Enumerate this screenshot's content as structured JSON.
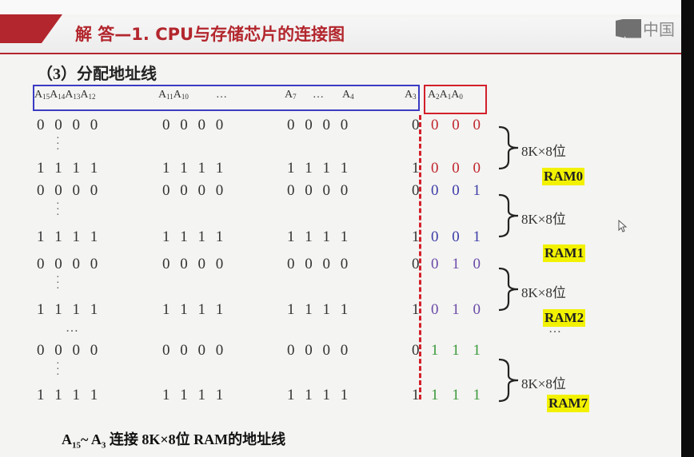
{
  "title": "解 答—1. CPU与存储芯片的连接图",
  "logo_text": "中国",
  "section": "（3）分配地址线",
  "header": {
    "g1": "A15A14A13A12",
    "g2": "A11A10",
    "g2_dots": "…",
    "g3a": "A7",
    "g3_dots": "…",
    "g3b": "A4",
    "g4": "A3",
    "g5": "A2A1A0"
  },
  "groups": [
    {
      "start": [
        "0 0 0 0",
        "0 0 0 0",
        "0 0 0 0",
        "0",
        "0 0 0"
      ],
      "end": [
        "1 1 1 1",
        "1 1 1 1",
        "1 1 1 1",
        "1",
        "0 0 0"
      ],
      "color": "#c0262d",
      "size": "8K×8位",
      "ram": "RAM0"
    },
    {
      "start": [
        "0 0 0 0",
        "0 0 0 0",
        "0 0 0 0",
        "0",
        "0 0 1"
      ],
      "end": [
        "1 1 1 1",
        "1 1 1 1",
        "1 1 1 1",
        "1",
        "0 0 1"
      ],
      "color": "#3c3ca8",
      "size": "8K×8位",
      "ram": "RAM1"
    },
    {
      "start": [
        "0 0 0 0",
        "0 0 0 0",
        "0 0 0 0",
        "0",
        "0 1 0"
      ],
      "end": [
        "1 1 1 1",
        "1 1 1 1",
        "1 1 1 1",
        "1",
        "0 1 0"
      ],
      "color": "#6a4aa8",
      "size": "8K×8位",
      "ram": "RAM2"
    },
    {
      "start": [
        "0 0 0 0",
        "0 0 0 0",
        "0 0 0 0",
        "0",
        "1 1 1"
      ],
      "end": [
        "1 1 1 1",
        "1 1 1 1",
        "1 1 1 1",
        "1",
        "1 1 1"
      ],
      "color": "#3a9a3a",
      "size": "8K×8位",
      "ram": "RAM7"
    }
  ],
  "ellipsis": "…",
  "footer": "A15~ A3 连接 8K×8位 RAM的地址线"
}
